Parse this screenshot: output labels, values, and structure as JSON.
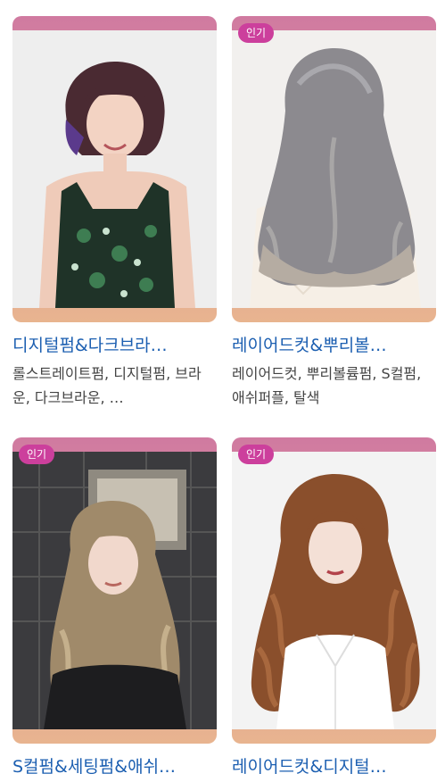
{
  "badge_label": "인기",
  "cards": [
    {
      "title": "디지털펌&다크브라…",
      "tags": "롤스트레이트펌, 디지털펌, 브라운, 다크브라운, …",
      "popular": false
    },
    {
      "title": "레이어드컷&뿌리볼…",
      "tags": "레이어드컷, 뿌리볼륨펌, S컬펌, 애쉬퍼플, 탈색",
      "popular": true
    },
    {
      "title": "S컬펌&세팅펌&애쉬…",
      "tags": "",
      "popular": true
    },
    {
      "title": "레이어드컷&디지털…",
      "tags": "",
      "popular": true
    }
  ]
}
